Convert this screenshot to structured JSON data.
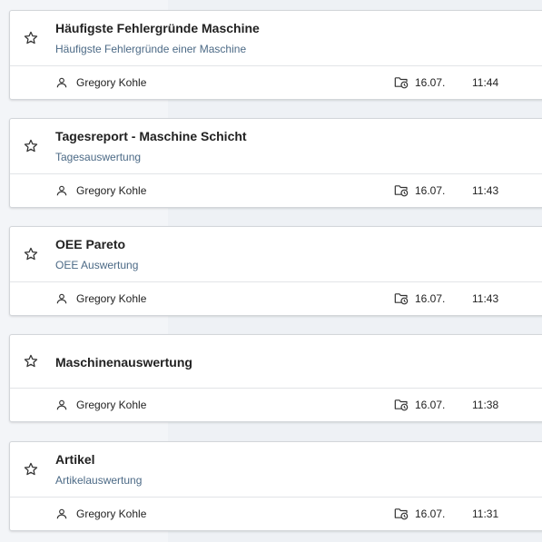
{
  "reports": [
    {
      "title": "Häufigste Fehlergründe Maschine",
      "subtitle": "Häufigste Fehlergründe einer Maschine",
      "author": "Gregory Kohle",
      "date": "16.07.",
      "time": "11:44"
    },
    {
      "title": "Tagesreport - Maschine Schicht",
      "subtitle": "Tagesauswertung",
      "author": "Gregory Kohle",
      "date": "16.07.",
      "time": "11:43"
    },
    {
      "title": "OEE Pareto",
      "subtitle": "OEE Auswertung",
      "author": "Gregory Kohle",
      "date": "16.07.",
      "time": "11:43"
    },
    {
      "title": "Maschinenauswertung",
      "subtitle": "",
      "author": "Gregory Kohle",
      "date": "16.07.",
      "time": "11:38"
    },
    {
      "title": "Artikel",
      "subtitle": "Artikelauswertung",
      "author": "Gregory Kohle",
      "date": "16.07.",
      "time": "11:31"
    }
  ],
  "icons": {
    "favorite": "star-outline-icon",
    "author": "person-outline-icon",
    "modified": "folder-clock-icon"
  },
  "colors": {
    "background": "#eef1f5",
    "card": "#ffffff",
    "subtitle": "#4c6a86",
    "text": "#222222"
  }
}
